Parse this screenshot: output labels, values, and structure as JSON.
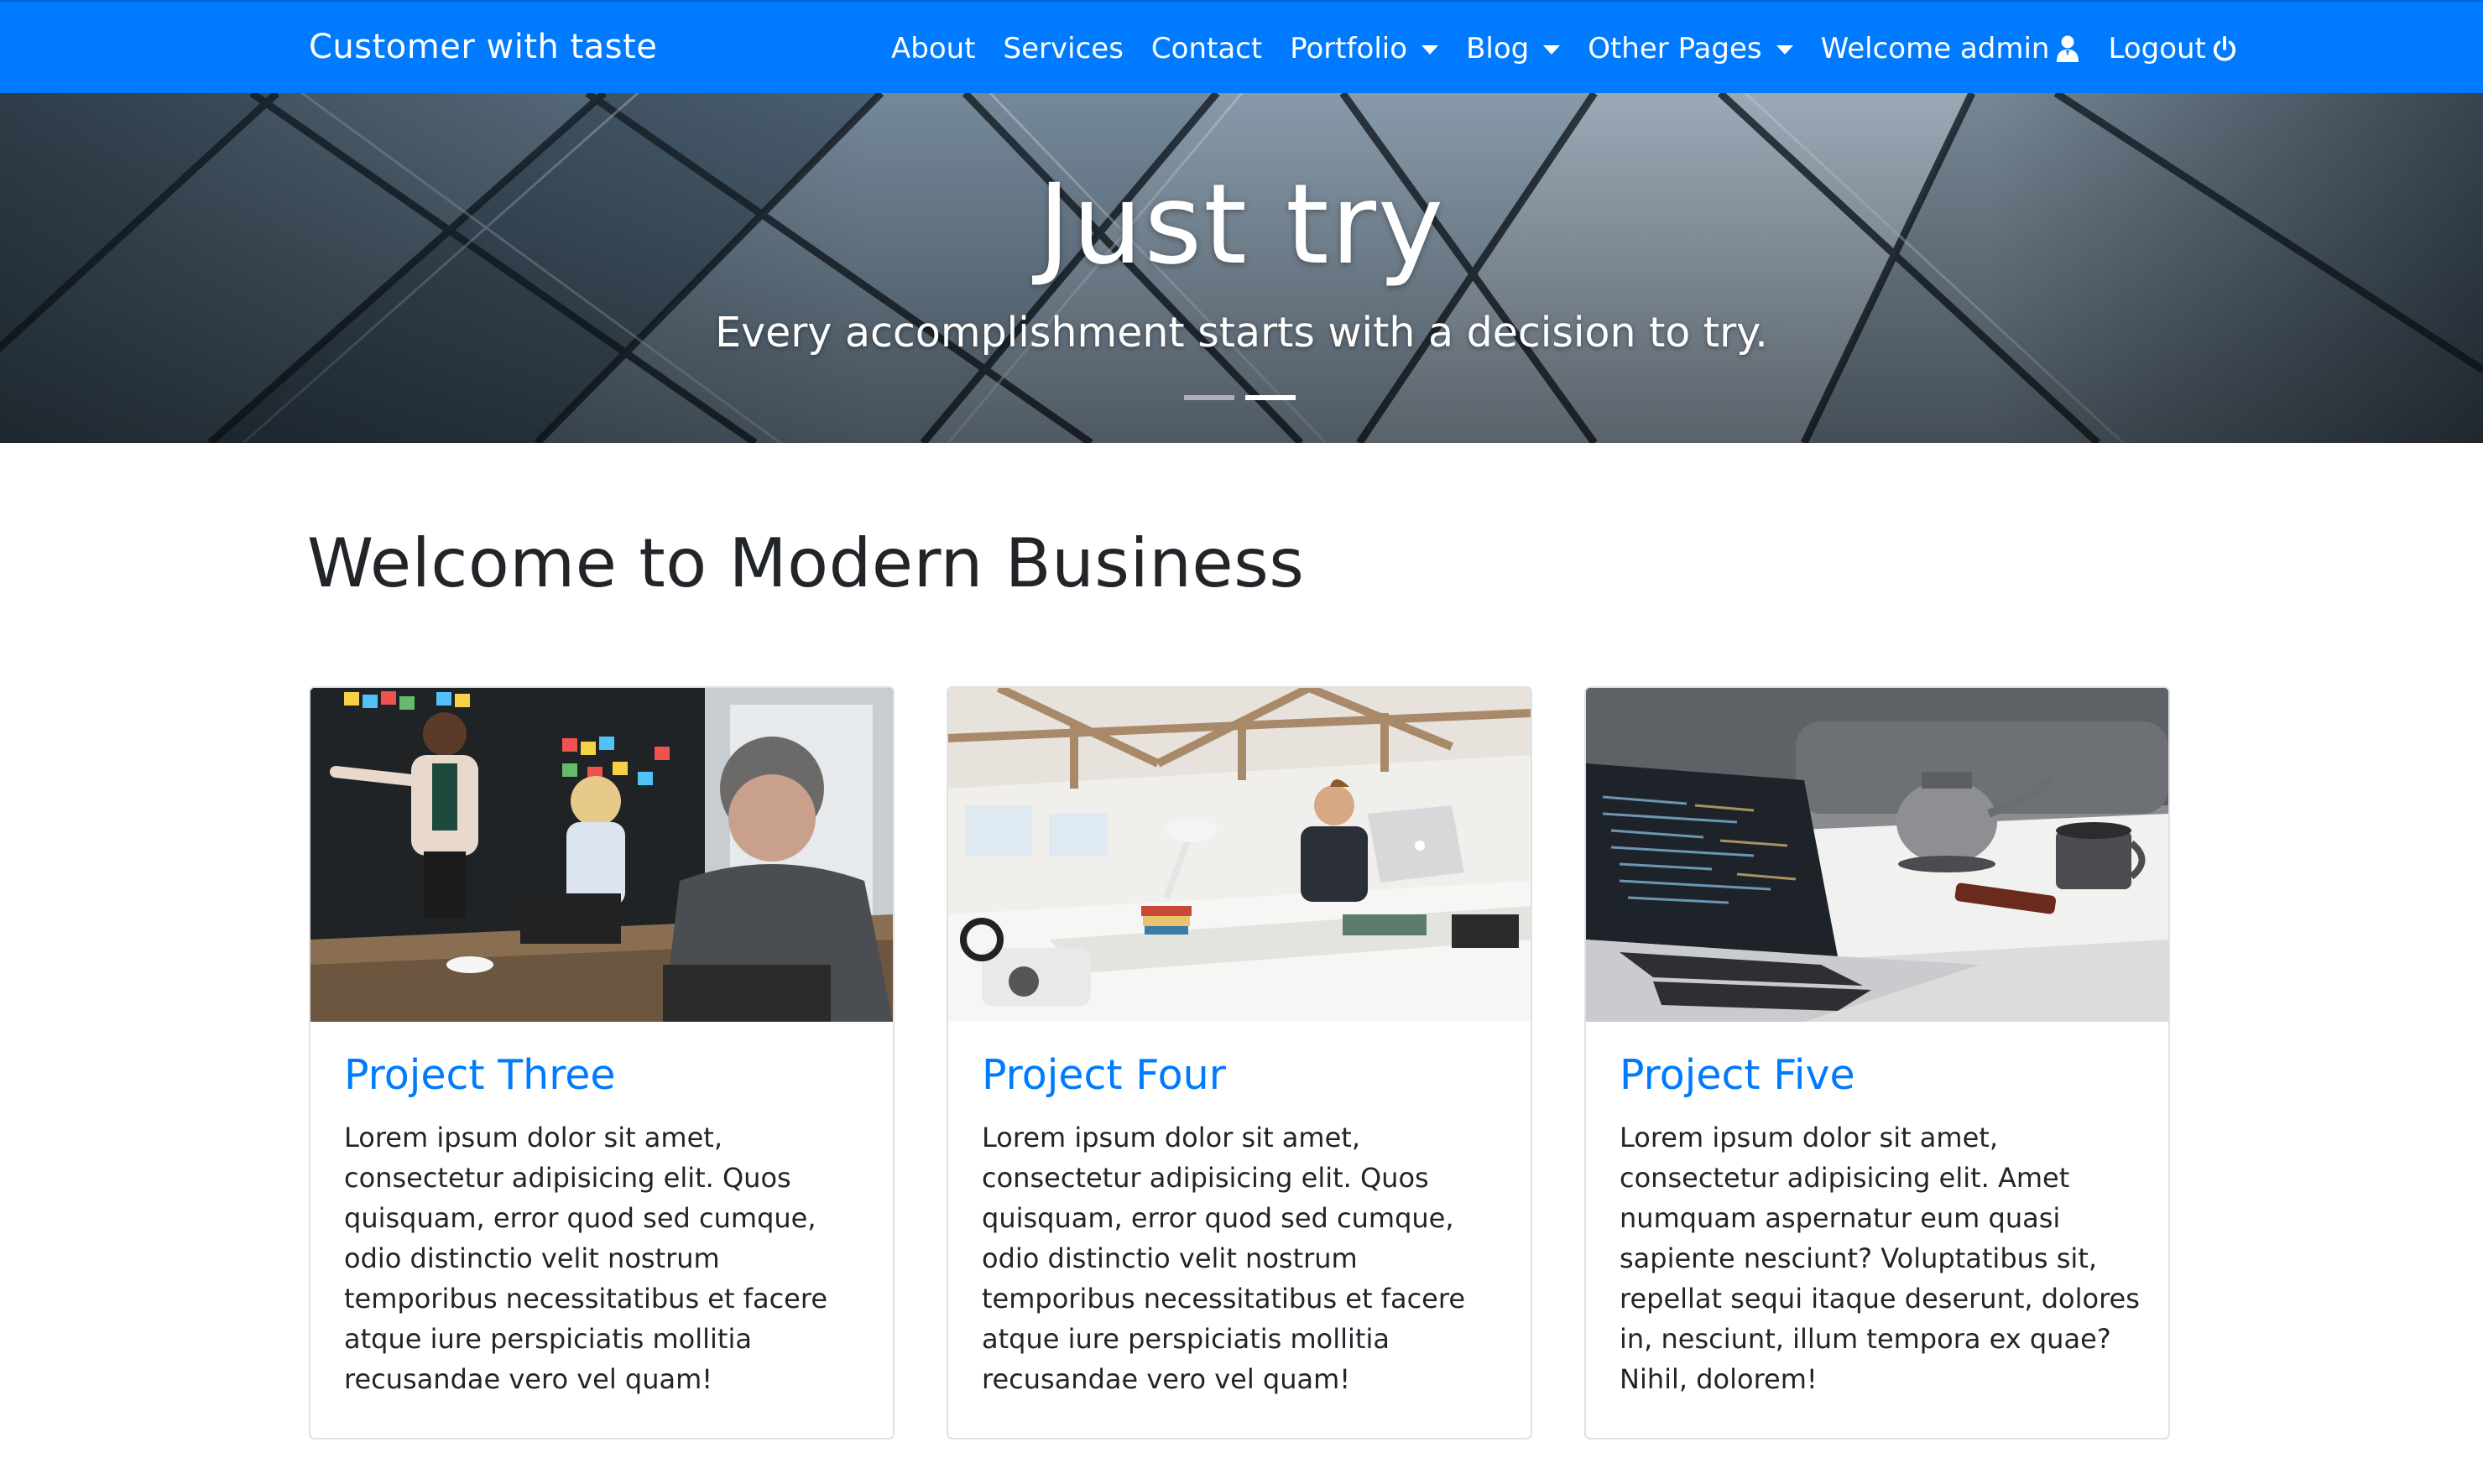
{
  "navbar": {
    "brand": "Customer with taste",
    "items": [
      {
        "label": "About",
        "dropdown": false
      },
      {
        "label": "Services",
        "dropdown": false
      },
      {
        "label": "Contact",
        "dropdown": false
      },
      {
        "label": "Portfolio",
        "dropdown": true
      },
      {
        "label": "Blog",
        "dropdown": true
      },
      {
        "label": "Other Pages",
        "dropdown": true
      },
      {
        "label": "Welcome admin",
        "icon": "user-icon"
      },
      {
        "label": "Logout",
        "icon": "power-icon"
      }
    ]
  },
  "hero": {
    "title": "Just try",
    "subtitle": "Every accomplishment starts with a decision to try.",
    "slide_count": 2,
    "active_slide": 2
  },
  "main": {
    "title": "Welcome to Modern Business",
    "cards": [
      {
        "title": "Project Three",
        "text": "Lorem ipsum dolor sit amet, consectetur adipisicing elit. Quos quisquam, error quod sed cumque, odio distinctio velit nostrum temporibus necessitatibus et facere atque iure perspiciatis mollitia recusandae vero vel quam!",
        "image": "office-meeting-photo"
      },
      {
        "title": "Project Four",
        "text": "Lorem ipsum dolor sit amet, consectetur adipisicing elit. Quos quisquam, error quod sed cumque, odio distinctio velit nostrum temporibus necessitatibus et facere atque iure perspiciatis mollitia recusandae vero vel quam!",
        "image": "open-office-photo"
      },
      {
        "title": "Project Five",
        "text": "Lorem ipsum dolor sit amet, consectetur adipisicing elit. Amet numquam aspernatur eum quasi sapiente nesciunt? Voluptatibus sit, repellat sequi itaque deserunt, dolores in, nesciunt, illum tempora ex quae? Nihil, dolorem!",
        "image": "laptop-kettle-photo"
      }
    ]
  },
  "colors": {
    "primary": "#007bff",
    "text": "#212529",
    "card_border": "#dfe1e4"
  }
}
